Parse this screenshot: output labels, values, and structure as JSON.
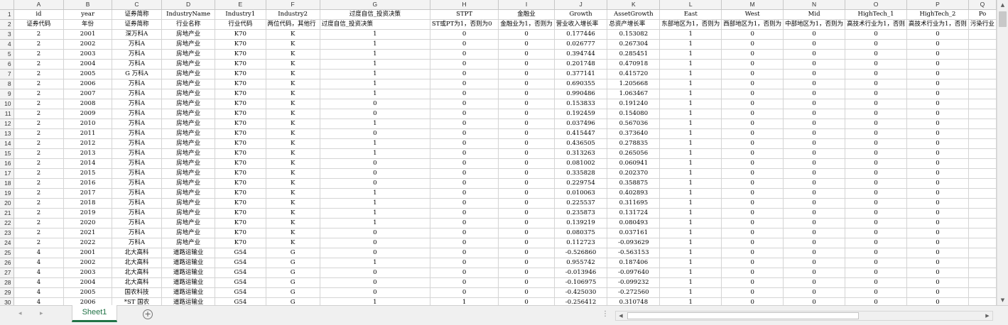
{
  "columns": [
    "A",
    "B",
    "C",
    "D",
    "E",
    "F",
    "G",
    "H",
    "I",
    "J",
    "K",
    "L",
    "M",
    "N",
    "O",
    "P",
    "Q"
  ],
  "row_numbers": [
    "1",
    "2",
    "3",
    "4",
    "5",
    "6",
    "7",
    "8",
    "9",
    "10",
    "11",
    "12",
    "13",
    "14",
    "15",
    "16",
    "17",
    "18",
    "19",
    "20",
    "21",
    "22",
    "23",
    "24",
    "25",
    "26",
    "27",
    "28",
    "29",
    "30"
  ],
  "rows": [
    [
      "id",
      "year",
      "证券简称",
      "IndustryName",
      "Industry1",
      "Industry2",
      "过度自信_投资决策",
      "STPT",
      "金融业",
      "Growth",
      "AssetGrowth",
      "East",
      "West",
      "Mid",
      "HighTech_1",
      "HighTech_2",
      "Po"
    ],
    [
      "证券代码",
      "年份",
      "证券简称",
      "行业名称",
      "行业代码",
      "两位代码，其他行",
      "过度自信_投资决策",
      "ST或PT为1，否则为0",
      "金融业为1，否则为",
      "营业收入增长率",
      "总资产增长率",
      "东部地区为1，否则为",
      "西部地区为1，否则为",
      "中部地区为1，否则为",
      "高技术行业为1，否则",
      "高技术行业为1，否则",
      "污染行业"
    ],
    [
      "2",
      "2001",
      "深万科A",
      "房地产业",
      "K70",
      "K",
      "1",
      "0",
      "0",
      "0.177446",
      "0.153082",
      "1",
      "0",
      "0",
      "0",
      "0",
      ""
    ],
    [
      "2",
      "2002",
      "万科A",
      "房地产业",
      "K70",
      "K",
      "1",
      "0",
      "0",
      "0.026777",
      "0.267304",
      "1",
      "0",
      "0",
      "0",
      "0",
      ""
    ],
    [
      "2",
      "2003",
      "万科A",
      "房地产业",
      "K70",
      "K",
      "1",
      "0",
      "0",
      "0.394744",
      "0.285451",
      "1",
      "0",
      "0",
      "0",
      "0",
      ""
    ],
    [
      "2",
      "2004",
      "万科A",
      "房地产业",
      "K70",
      "K",
      "1",
      "0",
      "0",
      "0.201748",
      "0.470918",
      "1",
      "0",
      "0",
      "0",
      "0",
      ""
    ],
    [
      "2",
      "2005",
      "G 万科A",
      "房地产业",
      "K70",
      "K",
      "1",
      "0",
      "0",
      "0.377141",
      "0.415720",
      "1",
      "0",
      "0",
      "0",
      "0",
      ""
    ],
    [
      "2",
      "2006",
      "万科A",
      "房地产业",
      "K70",
      "K",
      "1",
      "0",
      "0",
      "0.690355",
      "1.205668",
      "1",
      "0",
      "0",
      "0",
      "0",
      ""
    ],
    [
      "2",
      "2007",
      "万科A",
      "房地产业",
      "K70",
      "K",
      "1",
      "0",
      "0",
      "0.990486",
      "1.063467",
      "1",
      "0",
      "0",
      "0",
      "0",
      ""
    ],
    [
      "2",
      "2008",
      "万科A",
      "房地产业",
      "K70",
      "K",
      "0",
      "0",
      "0",
      "0.153833",
      "0.191240",
      "1",
      "0",
      "0",
      "0",
      "0",
      ""
    ],
    [
      "2",
      "2009",
      "万科A",
      "房地产业",
      "K70",
      "K",
      "0",
      "0",
      "0",
      "0.192459",
      "0.154080",
      "1",
      "0",
      "0",
      "0",
      "0",
      ""
    ],
    [
      "2",
      "2010",
      "万科A",
      "房地产业",
      "K70",
      "K",
      "1",
      "0",
      "0",
      "0.037496",
      "0.567036",
      "1",
      "0",
      "0",
      "0",
      "0",
      ""
    ],
    [
      "2",
      "2011",
      "万科A",
      "房地产业",
      "K70",
      "K",
      "0",
      "0",
      "0",
      "0.415447",
      "0.373640",
      "1",
      "0",
      "0",
      "0",
      "0",
      ""
    ],
    [
      "2",
      "2012",
      "万科A",
      "房地产业",
      "K70",
      "K",
      "1",
      "0",
      "0",
      "0.436505",
      "0.278835",
      "1",
      "0",
      "0",
      "0",
      "0",
      ""
    ],
    [
      "2",
      "2013",
      "万科A",
      "房地产业",
      "K70",
      "K",
      "1",
      "0",
      "0",
      "0.313263",
      "0.265056",
      "1",
      "0",
      "0",
      "0",
      "0",
      ""
    ],
    [
      "2",
      "2014",
      "万科A",
      "房地产业",
      "K70",
      "K",
      "0",
      "0",
      "0",
      "0.081002",
      "0.060941",
      "1",
      "0",
      "0",
      "0",
      "0",
      ""
    ],
    [
      "2",
      "2015",
      "万科A",
      "房地产业",
      "K70",
      "K",
      "0",
      "0",
      "0",
      "0.335828",
      "0.202370",
      "1",
      "0",
      "0",
      "0",
      "0",
      ""
    ],
    [
      "2",
      "2016",
      "万科A",
      "房地产业",
      "K70",
      "K",
      "0",
      "0",
      "0",
      "0.229754",
      "0.358875",
      "1",
      "0",
      "0",
      "0",
      "0",
      ""
    ],
    [
      "2",
      "2017",
      "万科A",
      "房地产业",
      "K70",
      "K",
      "1",
      "0",
      "0",
      "0.010063",
      "0.402893",
      "1",
      "0",
      "0",
      "0",
      "0",
      ""
    ],
    [
      "2",
      "2018",
      "万科A",
      "房地产业",
      "K70",
      "K",
      "1",
      "0",
      "0",
      "0.225537",
      "0.311695",
      "1",
      "0",
      "0",
      "0",
      "0",
      ""
    ],
    [
      "2",
      "2019",
      "万科A",
      "房地产业",
      "K70",
      "K",
      "1",
      "0",
      "0",
      "0.235873",
      "0.131724",
      "1",
      "0",
      "0",
      "0",
      "0",
      ""
    ],
    [
      "2",
      "2020",
      "万科A",
      "房地产业",
      "K70",
      "K",
      "1",
      "0",
      "0",
      "0.139219",
      "0.080493",
      "1",
      "0",
      "0",
      "0",
      "0",
      ""
    ],
    [
      "2",
      "2021",
      "万科A",
      "房地产业",
      "K70",
      "K",
      "0",
      "0",
      "0",
      "0.080375",
      "0.037161",
      "1",
      "0",
      "0",
      "0",
      "0",
      ""
    ],
    [
      "2",
      "2022",
      "万科A",
      "房地产业",
      "K70",
      "K",
      "0",
      "0",
      "0",
      "0.112723",
      "-0.093629",
      "1",
      "0",
      "0",
      "0",
      "0",
      ""
    ],
    [
      "4",
      "2001",
      "北大高科",
      "道路运输业",
      "G54",
      "G",
      "0",
      "0",
      "0",
      "-0.526860",
      "-0.563153",
      "1",
      "0",
      "0",
      "0",
      "0",
      ""
    ],
    [
      "4",
      "2002",
      "北大高科",
      "道路运输业",
      "G54",
      "G",
      "1",
      "0",
      "0",
      "0.955742",
      "0.187406",
      "1",
      "0",
      "0",
      "0",
      "0",
      ""
    ],
    [
      "4",
      "2003",
      "北大高科",
      "道路运输业",
      "G54",
      "G",
      "0",
      "0",
      "0",
      "-0.013946",
      "-0.097640",
      "1",
      "0",
      "0",
      "0",
      "0",
      ""
    ],
    [
      "4",
      "2004",
      "北大高科",
      "道路运输业",
      "G54",
      "G",
      "0",
      "0",
      "0",
      "-0.106975",
      "-0.099232",
      "1",
      "0",
      "0",
      "0",
      "0",
      ""
    ],
    [
      "4",
      "2005",
      "国农科技",
      "道路运输业",
      "G54",
      "G",
      "0",
      "0",
      "0",
      "-0.425030",
      "-0.272560",
      "1",
      "0",
      "0",
      "0",
      "0",
      ""
    ],
    [
      "4",
      "2006",
      "*ST 国农",
      "道路运输业",
      "G54",
      "G",
      "1",
      "1",
      "0",
      "-0.256412",
      "0.310748",
      "1",
      "0",
      "0",
      "0",
      "0",
      ""
    ]
  ],
  "sheet_tab": "Sheet1",
  "icons": {
    "nav_prev": "◂",
    "nav_next": "▸",
    "add_sheet": "+",
    "scroll_up": "▲",
    "scroll_down": "▼",
    "scroll_left": "◀",
    "scroll_right": "▶",
    "tab_split": "⋮"
  },
  "colors": {
    "accent_green": "#217346",
    "grid_line": "#d4d4d4",
    "header_bg": "#f3f3f3"
  }
}
